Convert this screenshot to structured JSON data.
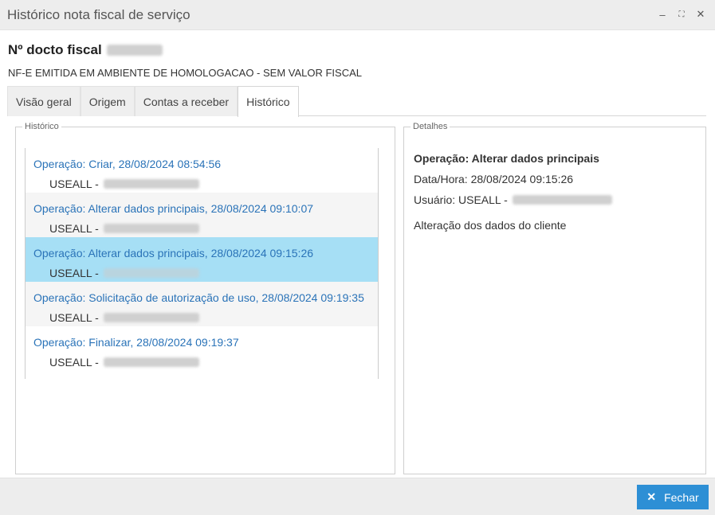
{
  "window": {
    "title": "Histórico nota fiscal de serviço",
    "controls": {
      "minimize": "–",
      "maximize": "⛶",
      "close": "✕"
    }
  },
  "document": {
    "label": "Nº docto fiscal",
    "subtitle": "NF-E EMITIDA EM AMBIENTE DE HOMOLOGACAO - SEM VALOR FISCAL"
  },
  "tabs": [
    {
      "label": "Visão geral",
      "active": false
    },
    {
      "label": "Origem",
      "active": false
    },
    {
      "label": "Contas a receber",
      "active": false
    },
    {
      "label": "Histórico",
      "active": true
    }
  ],
  "history": {
    "legend": "Histórico",
    "items": [
      {
        "operation": "Operação: Criar, 28/08/2024 08:54:56",
        "user": "USEALL -"
      },
      {
        "operation": "Operação: Alterar dados principais, 28/08/2024 09:10:07",
        "user": "USEALL -"
      },
      {
        "operation": "Operação: Alterar dados principais, 28/08/2024 09:15:26",
        "user": "USEALL -",
        "selected": true
      },
      {
        "operation": "Operação: Solicitação de autorização de uso, 28/08/2024 09:19:35",
        "user": "USEALL -"
      },
      {
        "operation": "Operação: Finalizar, 28/08/2024 09:19:37",
        "user": "USEALL -"
      }
    ]
  },
  "details": {
    "legend": "Detalhes",
    "operation": "Operação: Alterar dados principais",
    "datetime": "Data/Hora: 28/08/2024 09:15:26",
    "user": "Usuário: USEALL -",
    "description": "Alteração dos dados do cliente"
  },
  "footer": {
    "close_label": "Fechar",
    "close_icon": "✕"
  },
  "colors": {
    "accent": "#2d8fd5",
    "link": "#2a73b8",
    "selected_row": "#a6dff5"
  }
}
